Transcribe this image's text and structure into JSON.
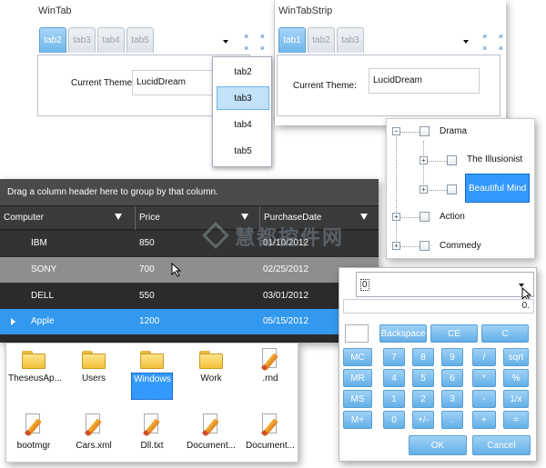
{
  "wintab": {
    "title": "WinTab",
    "tabs": [
      "tab2",
      "tab3",
      "tab4",
      "tab5"
    ],
    "active_tab": "tab2",
    "theme_label": "Current Theme:",
    "theme_value": "LucidDream",
    "popup_items": [
      "tab2",
      "tab3",
      "tab4",
      "tab5"
    ],
    "popup_selected": "tab3"
  },
  "wintabstrip": {
    "title": "WinTabStrip",
    "tabs": [
      "tab1",
      "tab2",
      "tab3"
    ],
    "active_tab": "tab1",
    "theme_label": "Current Theme:",
    "theme_value": "LucidDream"
  },
  "tree": {
    "items": [
      {
        "label": "Drama",
        "level": 0,
        "expander": "−"
      },
      {
        "label": "The Illusionist",
        "level": 1,
        "expander": "+"
      },
      {
        "label": "Beautiful Mind",
        "level": 1,
        "expander": "+",
        "selected": true
      },
      {
        "label": "Action",
        "level": 0,
        "expander": "+"
      },
      {
        "label": "Commedy",
        "level": 0,
        "expander": "+"
      }
    ]
  },
  "grid": {
    "group_hint": "Drag a column header here to group by that column.",
    "columns": [
      "Computer",
      "Price",
      "PurchaseDate"
    ],
    "rows": [
      {
        "computer": "IBM",
        "price": "850",
        "date": "01/10/2012"
      },
      {
        "computer": "SONY",
        "price": "700",
        "date": "02/25/2012"
      },
      {
        "computer": "DELL",
        "price": "550",
        "date": "03/01/2012"
      },
      {
        "computer": "Apple",
        "price": "1200",
        "date": "05/15/2012"
      }
    ],
    "hover_row": 1,
    "selected_row": 3,
    "colors": {
      "header": "#3a3a3a",
      "row_dark": "#333333",
      "row_alt": "#2b2b2b",
      "hover": "#8e8e8e",
      "selected": "#3399ee"
    }
  },
  "files": {
    "items": [
      {
        "label": "TheseusAp...",
        "icon": "folder-icon"
      },
      {
        "label": "Users",
        "icon": "folder-icon"
      },
      {
        "label": "Windows",
        "icon": "folder-icon",
        "selected": true
      },
      {
        "label": "Work",
        "icon": "folder-icon"
      },
      {
        "label": ".rnd",
        "icon": "document-icon"
      },
      {
        "label": "bootmgr",
        "icon": "document-icon"
      },
      {
        "label": "Cars.xml",
        "icon": "document-icon"
      },
      {
        "label": "Dll.txt",
        "icon": "document-icon"
      },
      {
        "label": "Document...",
        "icon": "document-icon"
      },
      {
        "label": "Document...",
        "icon": "document-icon"
      }
    ]
  },
  "calculator": {
    "input_value": "0",
    "display_value": "0.",
    "keys": [
      [
        "",
        "Backspace",
        "CE",
        "C"
      ],
      [
        "MC",
        "7",
        "8",
        "9",
        "/",
        "sqrt"
      ],
      [
        "MR",
        "4",
        "5",
        "6",
        "*",
        "%"
      ],
      [
        "MS",
        "1",
        "2",
        "3",
        "-",
        "1/x"
      ],
      [
        "M+",
        "0",
        "+/-",
        ".",
        "+",
        "="
      ]
    ],
    "ok_label": "OK",
    "cancel_label": "Cancel"
  },
  "watermark": "慧都控件网"
}
